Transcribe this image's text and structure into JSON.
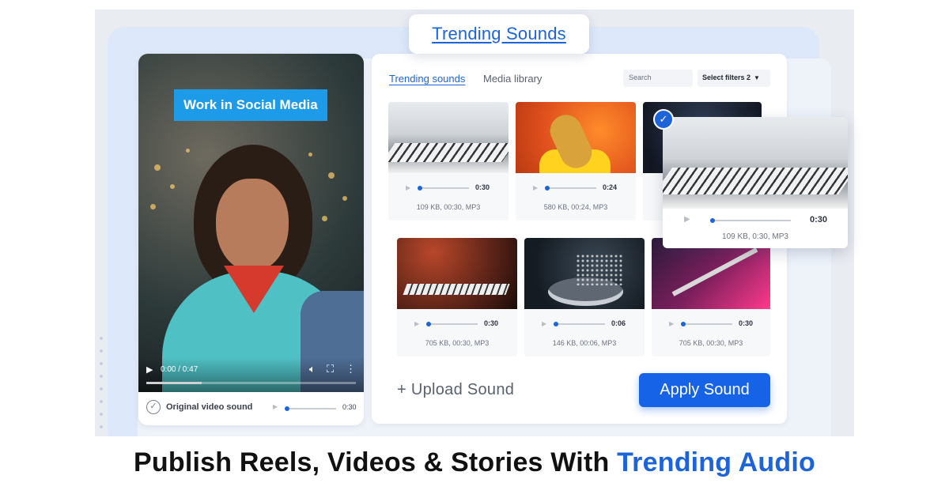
{
  "header": {
    "title": "Trending Sounds"
  },
  "video": {
    "overlay_text": "Work in Social Media",
    "play_icon": "play-icon",
    "time": "0:00 / 0:47",
    "original_sound_label": "Original video sound",
    "original_sound_time": "0:30"
  },
  "tabs": [
    {
      "label": "Trending sounds",
      "active": true
    },
    {
      "label": "Media library",
      "active": false
    }
  ],
  "search": {
    "placeholder": "Search"
  },
  "filters": {
    "label": "Select filters 2"
  },
  "sounds": [
    {
      "time": "0:30",
      "meta": "109 KB, 00:30, MP3",
      "progress": 0.05
    },
    {
      "time": "0:24",
      "meta": "580 KB, 00:24, MP3",
      "progress": 0.05
    },
    {
      "time": "0:30",
      "meta": "109 KB, 0:30, MP3",
      "progress": 0.05,
      "selected": true
    },
    {
      "time": "0:30",
      "meta": "705 KB, 00:30, MP3",
      "progress": 0.05
    },
    {
      "time": "0:06",
      "meta": "146 KB, 00:06, MP3",
      "progress": 0.05
    },
    {
      "time": "0:30",
      "meta": "705 KB, 00:30, MP3",
      "progress": 0.05
    }
  ],
  "actions": {
    "upload": "+ Upload Sound",
    "apply": "Apply Sound"
  },
  "headline": {
    "main": "Publish Reels, Videos & Stories With ",
    "accent": "Trending Audio"
  },
  "colors": {
    "accent": "#1c64d8",
    "button": "#1763e8",
    "tag": "#1e9be8"
  }
}
